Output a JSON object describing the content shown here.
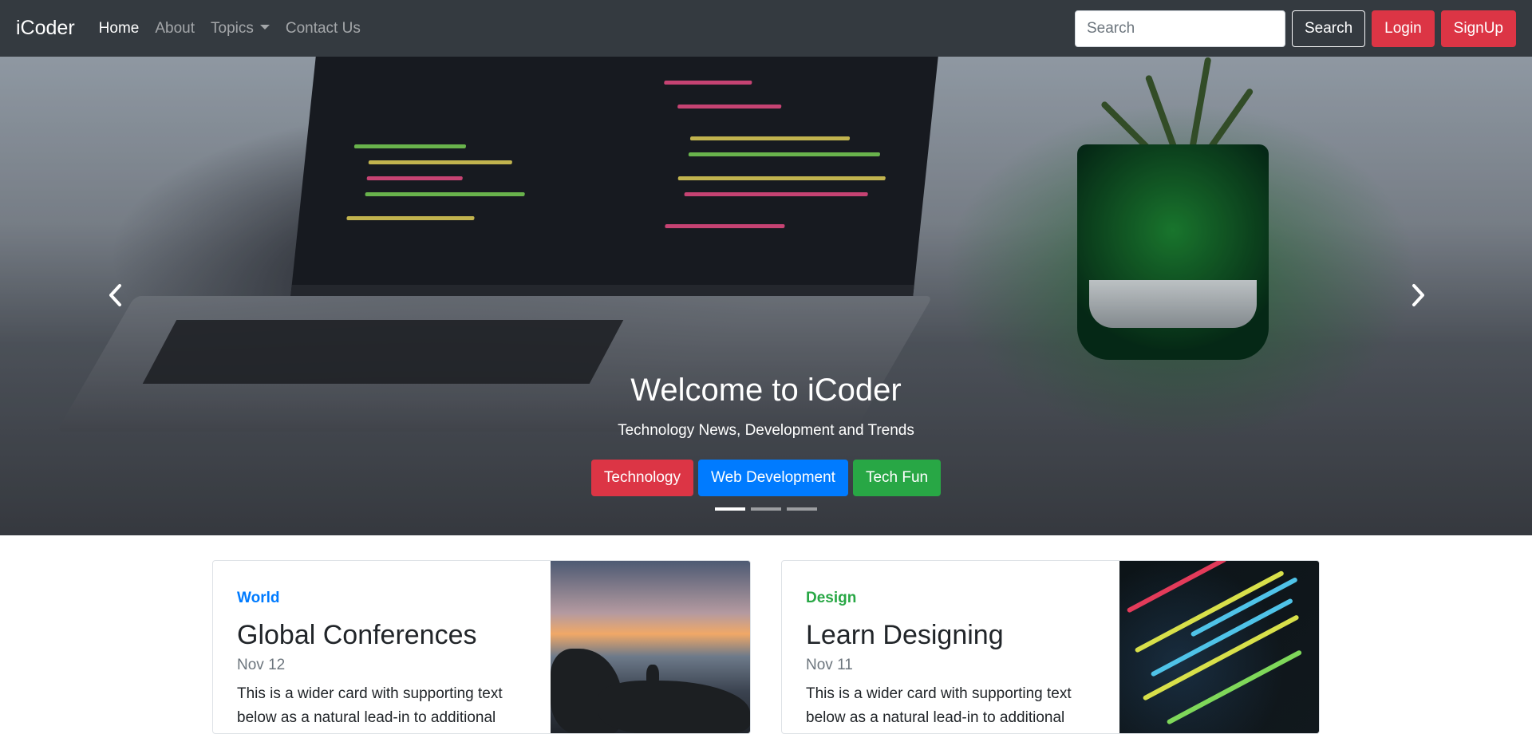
{
  "nav": {
    "brand": "iCoder",
    "links": [
      {
        "label": "Home"
      },
      {
        "label": "About"
      },
      {
        "label": "Topics"
      },
      {
        "label": "Contact Us"
      }
    ],
    "search_placeholder": "Search",
    "search_button": "Search",
    "login": "Login",
    "signup": "SignUp"
  },
  "hero": {
    "title": "Welcome to iCoder",
    "subtitle": "Technology News, Development and Trends",
    "buttons": [
      {
        "label": "Technology",
        "color": "#dc3545"
      },
      {
        "label": "Web Development",
        "color": "#007bff"
      },
      {
        "label": "Tech Fun",
        "color": "#28a745"
      }
    ],
    "slides": 3,
    "active_slide": 1
  },
  "cards": [
    {
      "category": "World",
      "category_color": "#007bff",
      "title": "Global Conferences",
      "date": "Nov 12",
      "text": "This is a wider card with supporting text below as a natural lead-in to additional"
    },
    {
      "category": "Design",
      "category_color": "#28a745",
      "title": "Learn Designing",
      "date": "Nov 11",
      "text": "This is a wider card with supporting text below as a natural lead-in to additional"
    }
  ],
  "colors": {
    "navbar_bg": "#343a40",
    "danger": "#dc3545",
    "primary": "#007bff",
    "success": "#28a745"
  }
}
